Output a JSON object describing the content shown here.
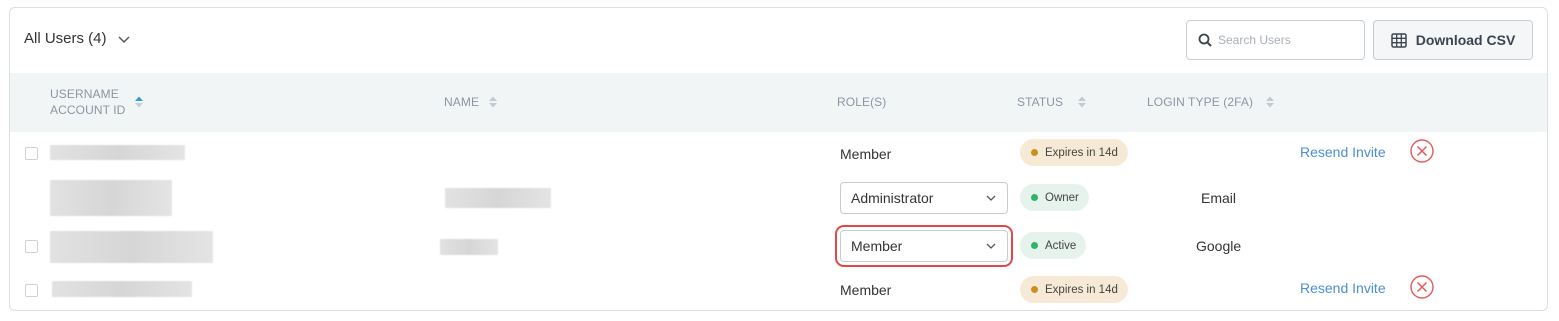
{
  "toolbar": {
    "filter_label": "All Users (4)",
    "search_placeholder": "Search Users",
    "search_value": "",
    "csv_label": "Download CSV"
  },
  "columns": {
    "username_line1": "USERNAME",
    "username_line2": "ACCOUNT ID",
    "name": "NAME",
    "roles": "ROLE(S)",
    "status": "STATUS",
    "login_type": "LOGIN TYPE (2FA)"
  },
  "sort": {
    "column": "username",
    "direction": "ascending"
  },
  "rows": [
    {
      "role": "Member",
      "role_editable": false,
      "status": "Expires in 14d",
      "status_kind": "pending",
      "login_type": "",
      "action": "Resend Invite",
      "has_checkbox": true
    },
    {
      "role": "Administrator",
      "role_editable": true,
      "status": "Owner",
      "status_kind": "active",
      "login_type": "Email",
      "action": "",
      "has_checkbox": false
    },
    {
      "role": "Member",
      "role_editable": true,
      "status": "Active",
      "status_kind": "active",
      "login_type": "Google",
      "action": "",
      "has_checkbox": true,
      "highlighted": true
    },
    {
      "role": "Member",
      "role_editable": false,
      "status": "Expires in 14d",
      "status_kind": "pending",
      "login_type": "",
      "action": "Resend Invite",
      "has_checkbox": true
    }
  ],
  "colors": {
    "accent_link": "#4a8fd1",
    "sort_active": "#2a9fd6",
    "pending_dot": "#c9901e",
    "active_dot": "#2fb36c",
    "delete_red": "#e45a5a",
    "highlight_red": "#e04848"
  }
}
